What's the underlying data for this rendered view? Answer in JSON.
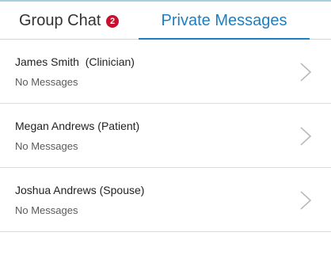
{
  "tabs": {
    "group_chat": {
      "label": "Group Chat",
      "badge_count": "2"
    },
    "private_messages": {
      "label": "Private Messages",
      "active": true
    }
  },
  "conversations": [
    {
      "name": "James Smith  (Clinician)",
      "preview": "No Messages",
      "icon": "chevron-right-icon"
    },
    {
      "name": "Megan Andrews (Patient)",
      "preview": "No Messages",
      "icon": "chevron-right-icon"
    },
    {
      "name": "Joshua Andrews (Spouse)",
      "preview": "No Messages",
      "icon": "chevron-right-icon"
    }
  ],
  "colors": {
    "accent": "#1b7fc4",
    "badge": "#c8102e",
    "top_line": "#a9cfe3",
    "divider": "#dcdcdc",
    "chevron": "#b8b8b8"
  }
}
